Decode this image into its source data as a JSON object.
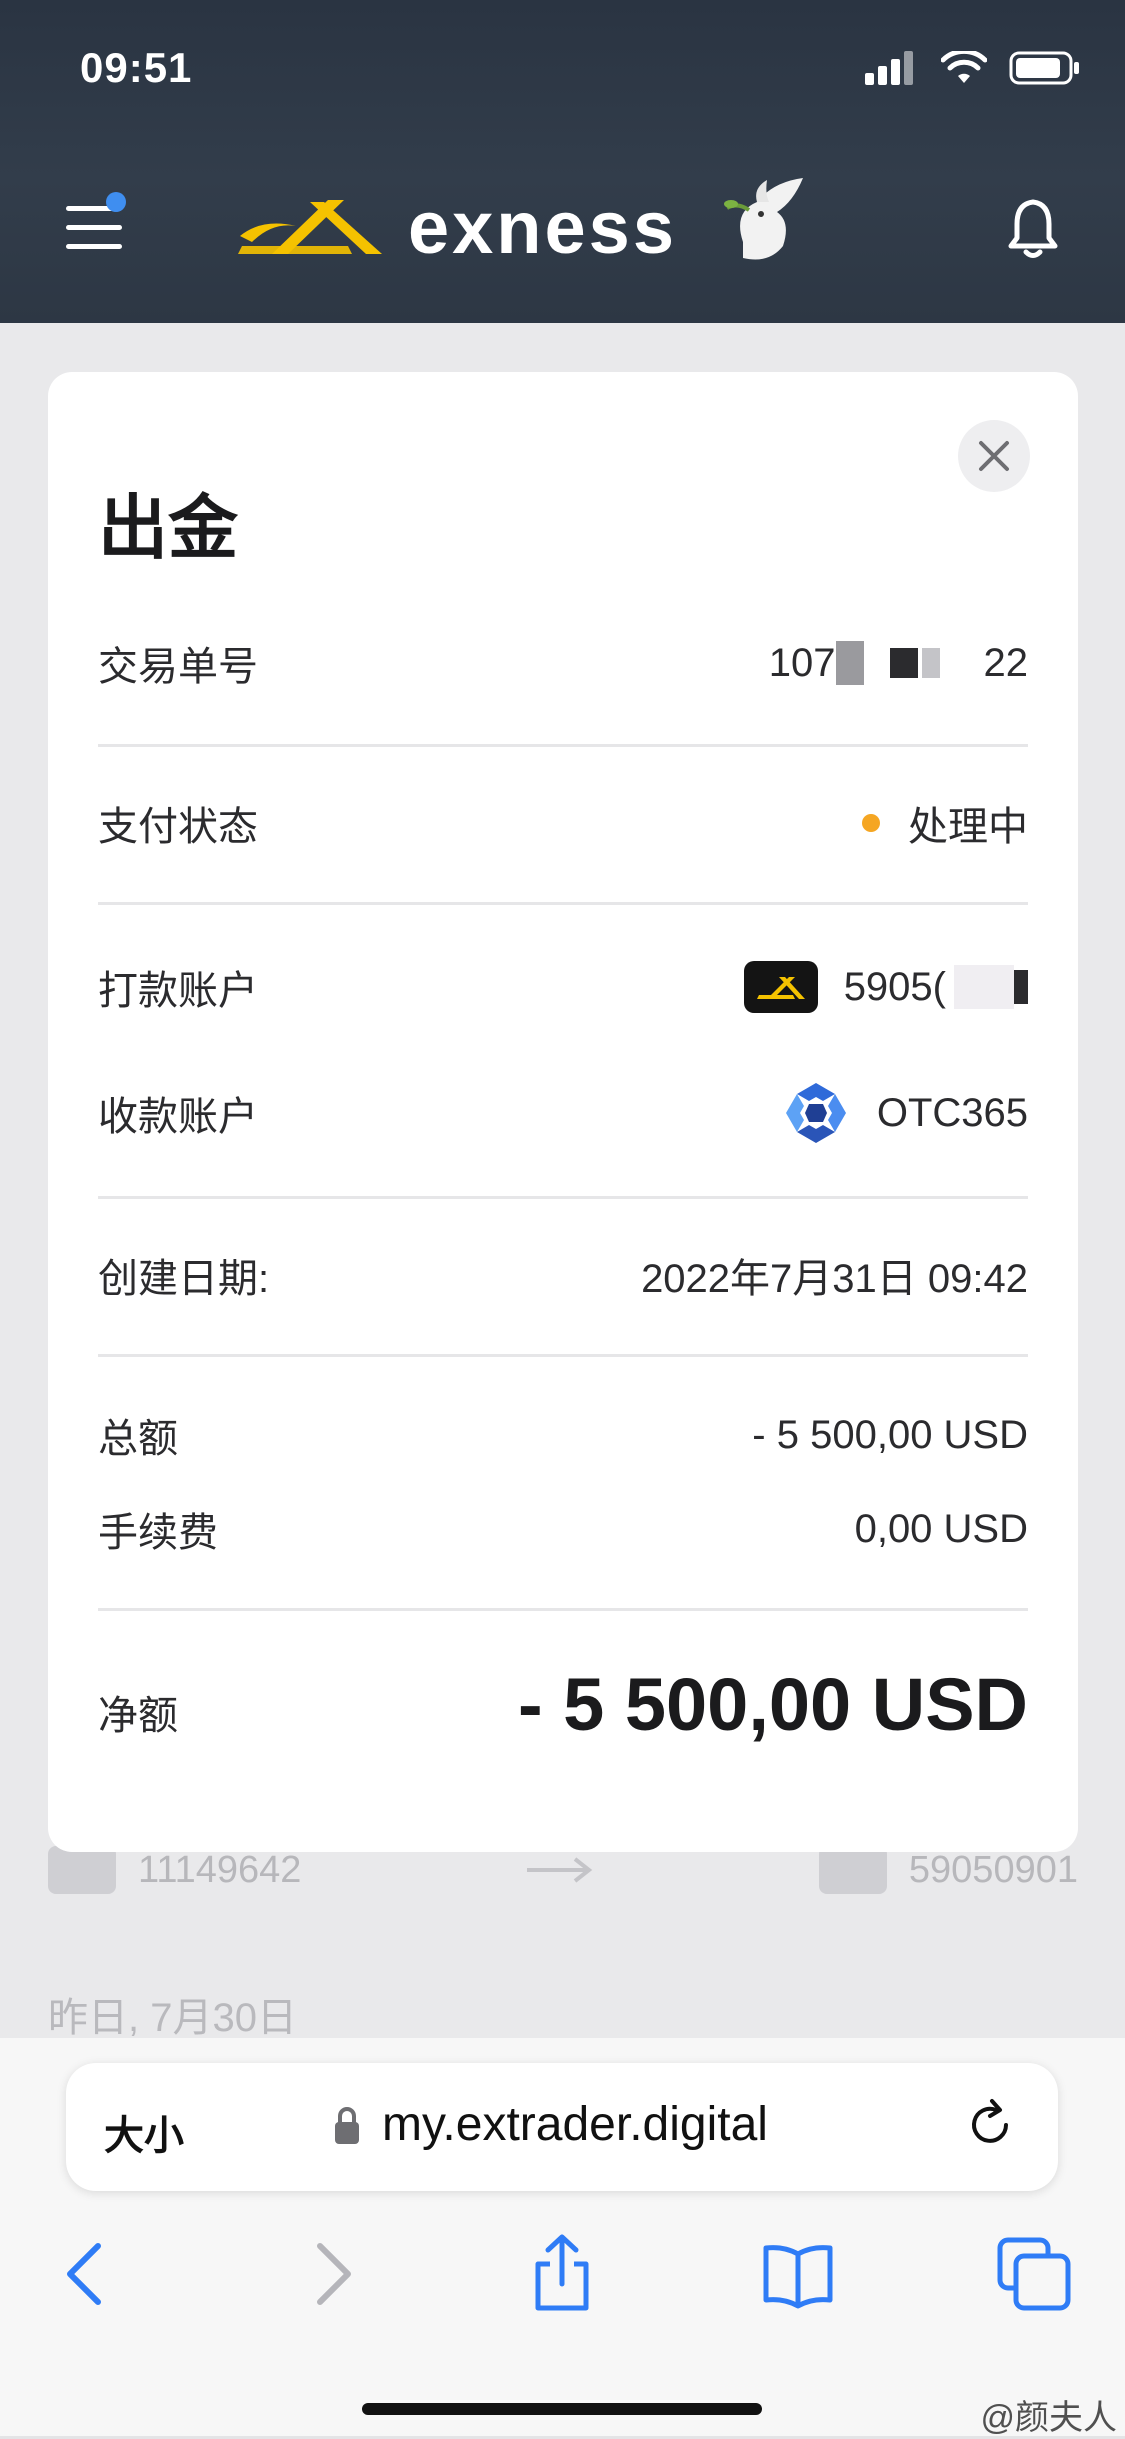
{
  "status_bar": {
    "time": "09:51"
  },
  "header": {
    "brand": "exness"
  },
  "modal": {
    "title": "出金",
    "transaction_label": "交易单号",
    "transaction_prefix": "107",
    "transaction_suffix": "22",
    "payment_status_label": "支付状态",
    "payment_status_value": "处理中",
    "payment_status_color": "#f5a623",
    "from_account_label": "打款账户",
    "from_account_value": "5905(",
    "to_account_label": "收款账户",
    "to_account_value": "OTC365",
    "created_label": "创建日期:",
    "created_value": "2022年7月31日 09:42",
    "total_label": "总额",
    "total_value": "- 5 500,00 USD",
    "fee_label": "手续费",
    "fee_value": "0,00 USD",
    "net_label": "净额",
    "net_value": "- 5 500,00 USD"
  },
  "background": {
    "row_from": "11149642",
    "row_to": "59050901",
    "date_header": "昨日, 7月30日"
  },
  "browser": {
    "text_size_label": "大小",
    "url": "my.extrader.digital"
  },
  "watermark": "@颜夫人",
  "colors": {
    "accent_yellow": "#f5c200",
    "link_blue": "#2f7cf6"
  }
}
